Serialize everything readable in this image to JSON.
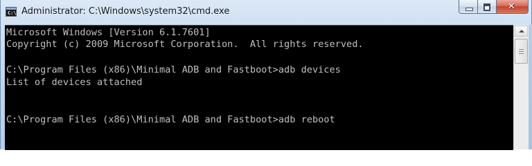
{
  "window": {
    "title": "Administrator: C:\\Windows\\system32\\cmd.exe",
    "app_icon_text": "C:\\",
    "icon": "cmd-icon"
  },
  "caption_buttons": {
    "minimize_icon": "minimize-icon",
    "maximize_icon": "maximize-icon",
    "close_icon": "close-icon",
    "close_glyph": "✕"
  },
  "console": {
    "lines": [
      "Microsoft Windows [Version 6.1.7601]",
      "Copyright (c) 2009 Microsoft Corporation.  All rights reserved.",
      "",
      "C:\\Program Files (x86)\\Minimal ADB and Fastboot>adb devices",
      "List of devices attached",
      "",
      "",
      "C:\\Program Files (x86)\\Minimal ADB and Fastboot>adb reboot"
    ],
    "text_color": "#c0c0c0",
    "background": "#000000"
  }
}
